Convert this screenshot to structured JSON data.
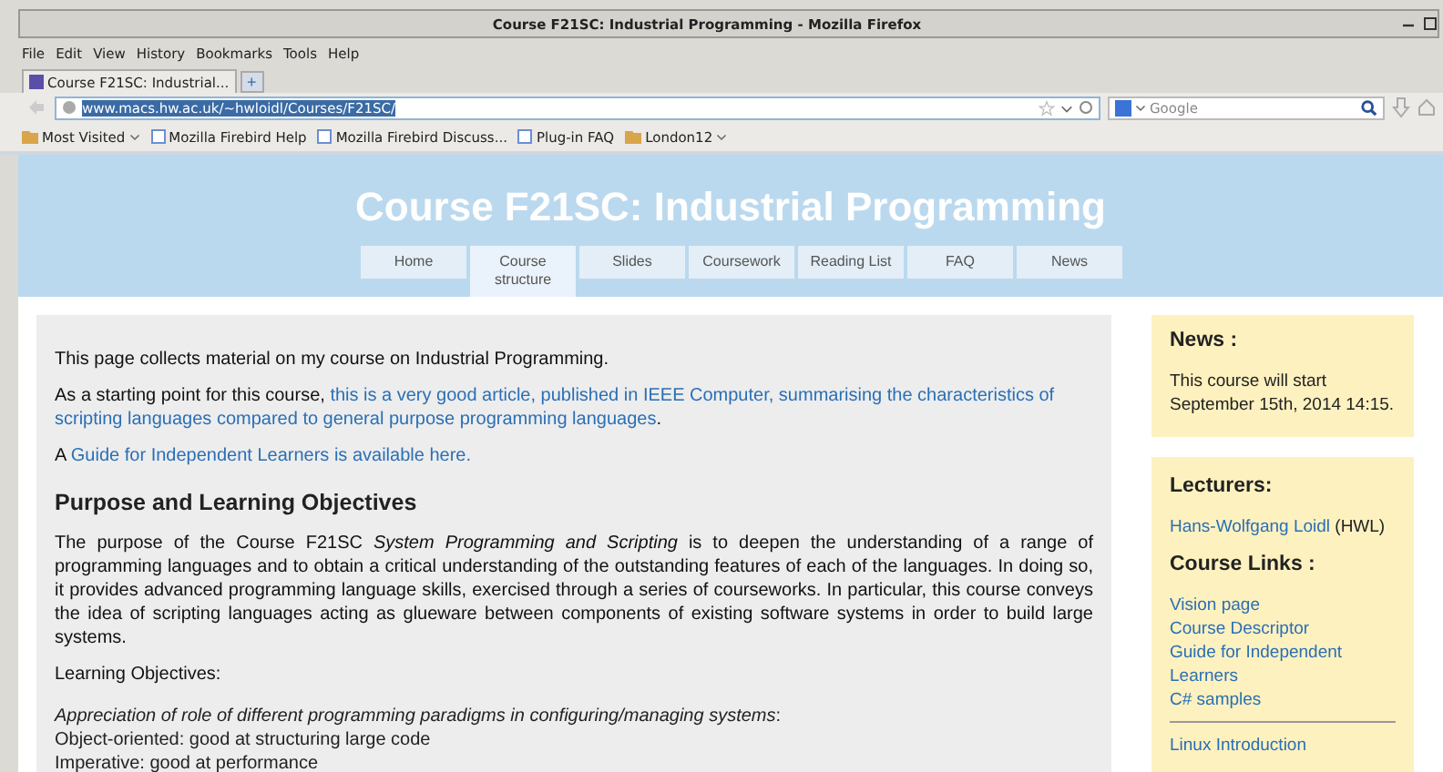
{
  "window": {
    "title": "Course F21SC: Industrial Programming - Mozilla Firefox"
  },
  "menu": [
    "File",
    "Edit",
    "View",
    "History",
    "Bookmarks",
    "Tools",
    "Help"
  ],
  "tabs": [
    {
      "label": "Course F21SC: Industrial...",
      "selected": true
    }
  ],
  "new_tab": "+",
  "address": {
    "value": "www.macs.hw.ac.uk/~hwloidl/Courses/F21SC/"
  },
  "search": {
    "placeholder": "Google"
  },
  "bookmarks": [
    {
      "label": "Most Visited",
      "kind": "menu"
    },
    {
      "label": "Mozilla Firebird Help",
      "kind": "link"
    },
    {
      "label": "Mozilla Firebird Discuss...",
      "kind": "link"
    },
    {
      "label": "Plug-in FAQ",
      "kind": "link"
    },
    {
      "label": "London12",
      "kind": "menu"
    }
  ],
  "page": {
    "title": "Course F21SC: Industrial Programming",
    "nav": [
      {
        "label": "Home",
        "selected": false
      },
      {
        "label": "Course structure",
        "selected": true
      },
      {
        "label": "Slides",
        "selected": false
      },
      {
        "label": "Coursework",
        "selected": false
      },
      {
        "label": "Reading List",
        "selected": false
      },
      {
        "label": "FAQ",
        "selected": false
      },
      {
        "label": "News",
        "selected": false
      }
    ],
    "intro": [
      [
        {
          "kind": "text",
          "text": "This page collects material on my course on Industrial Programming."
        }
      ],
      [
        {
          "kind": "text",
          "text": "As a starting point for this course, "
        },
        {
          "kind": "link",
          "text": "this is a very good article, published in IEEE Computer, summarising the characteristics of"
        },
        {
          "kind": "link",
          "text": "scripting languages compared to general purpose programming languages"
        },
        {
          "kind": "text",
          "text": "."
        }
      ],
      [
        {
          "kind": "text",
          "text": "A "
        },
        {
          "kind": "link",
          "text": "Guide for Independent Learners is available here."
        }
      ]
    ],
    "heading": "Purpose and Learning Objectives",
    "purpose": "The purpose of the Course F21SC *System Programming and Scripting* is to deepen the understanding of a range of programming languages and to obtain a critical understanding of the outstanding features of each of the languages. In doing so, it provides advanced programming language skills, exercised through a series of courseworks. In particular, this course conveys the idea of scripting languages acting as glueware between components of existing software systems in order to build large systems.",
    "objectives_label": "Learning Objectives:",
    "objectives": [
      "*Appreciation of role of different programming paradigms in configuring/managing systems*:",
      "Object-oriented: good at structuring large code",
      "Imperative: good at performance"
    ]
  },
  "news": {
    "title": "News :",
    "text": "This course will start September 15th, 2014 14:15."
  },
  "lecturers": {
    "title": "Lecturers:",
    "name": "Hans-Wolfgang Loidl",
    "suffix": "(HWL)"
  },
  "course_links": {
    "title": "Course Links :",
    "links": [
      "Vision page",
      "Course Descriptor",
      "Guide for Independent Learners",
      "C# samples"
    ],
    "more": [
      "Linux Introduction"
    ]
  }
}
